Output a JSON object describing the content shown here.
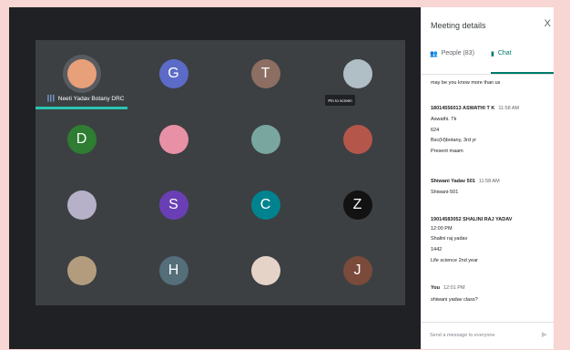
{
  "colors": {
    "accent": "#00796b",
    "speaker_bar": "#2ac4b3"
  },
  "grid": {
    "tiles": [
      {
        "letter": "",
        "color": "#e8a07a",
        "photo": true,
        "speaking": true,
        "name": "Neeti Yadav Botany DRC"
      },
      {
        "letter": "G",
        "color": "#5b6bc7"
      },
      {
        "letter": "T",
        "color": "#8d6e63"
      },
      {
        "letter": "",
        "color": "#b0bec5",
        "photo": true
      },
      {
        "letter": "D",
        "color": "#2e7d32"
      },
      {
        "letter": "",
        "color": "#e891a6",
        "photo": true
      },
      {
        "letter": "",
        "color": "#7aa6a0",
        "photo": true
      },
      {
        "letter": "",
        "color": "#b5564b",
        "photo": true
      },
      {
        "letter": "",
        "color": "#b7b0c9",
        "photo": true
      },
      {
        "letter": "S",
        "color": "#6a3fb5"
      },
      {
        "letter": "C",
        "color": "#00838f"
      },
      {
        "letter": "Z",
        "color": "#121212"
      },
      {
        "letter": "",
        "color": "#b39c7d",
        "photo": true
      },
      {
        "letter": "H",
        "color": "#546e7a"
      },
      {
        "letter": "",
        "color": "#e6d3c7",
        "photo": true
      },
      {
        "letter": "J",
        "color": "#7a4a3a"
      }
    ],
    "pin_tooltip": "Pin to screen"
  },
  "panel": {
    "title": "Meeting details",
    "close": "X",
    "tabs": {
      "people": "People (83)",
      "chat": "Chat"
    },
    "chat": {
      "lines": [
        {
          "text": "may be you know more than us",
          "top": 0
        },
        {
          "sender": "18014556013 ASWATHI T K",
          "time": "11:58 AM"
        },
        {
          "text": "Aswathi. Tk"
        },
        {
          "text": "624"
        },
        {
          "text": "Bsc(H)botany, 3rd yr"
        },
        {
          "text": "Present maam"
        },
        {
          "sender": "Shiwani Yadav 501",
          "time": "11:58 AM"
        },
        {
          "text": "Shiwani-501"
        },
        {
          "sender": "19014583052 SHALINI RAJ YADAV"
        },
        {
          "text": "12:00 PM"
        },
        {
          "text": "Shalini raj yadav"
        },
        {
          "text": "1442"
        },
        {
          "text": "Life science 2nd year"
        },
        {
          "sender": "You",
          "time": "12:01 PM"
        },
        {
          "text": "shiwani yadav class?"
        }
      ]
    },
    "composer_placeholder": "Send a message to everyone"
  }
}
